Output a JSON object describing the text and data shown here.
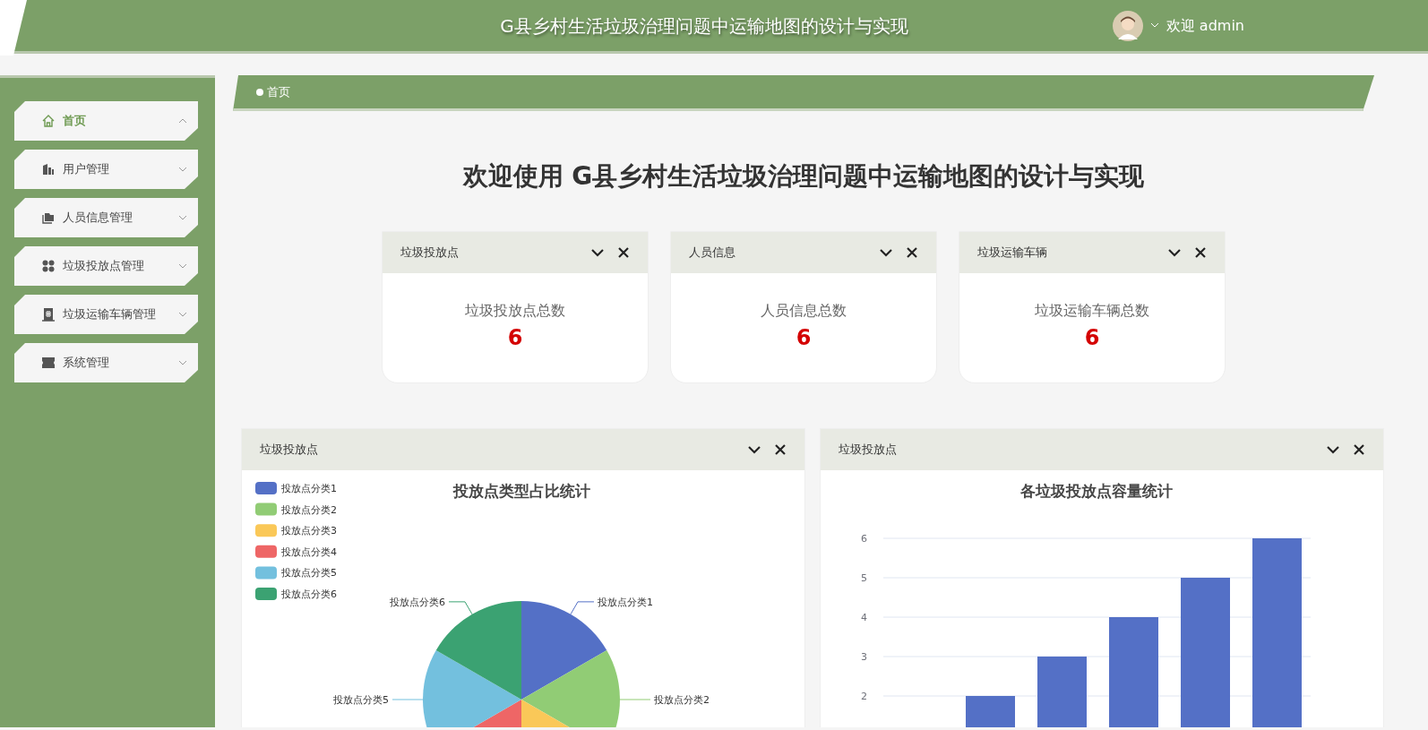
{
  "header": {
    "title": "G县乡村生活垃圾治理问题中运输地图的设计与实现",
    "user_greeting": "欢迎 admin"
  },
  "sidebar": {
    "items": [
      {
        "label": "首页",
        "selected": true,
        "expanded": true
      },
      {
        "label": "用户管理",
        "selected": false,
        "expanded": false
      },
      {
        "label": "人员信息管理",
        "selected": false,
        "expanded": false
      },
      {
        "label": "垃圾投放点管理",
        "selected": false,
        "expanded": false
      },
      {
        "label": "垃圾运输车辆管理",
        "selected": false,
        "expanded": false
      },
      {
        "label": "系统管理",
        "selected": false,
        "expanded": false
      }
    ]
  },
  "breadcrumb": [
    "首页"
  ],
  "welcome_title": "欢迎使用 G县乡村生活垃圾治理问题中运输地图的设计与实现",
  "stat_cards": [
    {
      "title": "垃圾投放点",
      "label": "垃圾投放点总数",
      "value": "6"
    },
    {
      "title": "人员信息",
      "label": "人员信息总数",
      "value": "6"
    },
    {
      "title": "垃圾运输车辆",
      "label": "垃圾运输车辆总数",
      "value": "6"
    }
  ],
  "chart_cards": [
    {
      "title": "垃圾投放点",
      "chart_data": {
        "type": "pie",
        "title": "投放点类型占比统计",
        "categories": [
          "投放点分类1",
          "投放点分类2",
          "投放点分类3",
          "投放点分类4",
          "投放点分类5",
          "投放点分类6"
        ],
        "values": [
          1,
          1,
          1,
          1,
          1,
          1
        ],
        "legend": "top-left"
      }
    },
    {
      "title": "垃圾投放点",
      "chart_data": {
        "type": "bar",
        "title": "各垃圾投放点容量统计",
        "values": [
          null,
          2,
          3,
          4,
          5,
          6
        ],
        "ylim": [
          0,
          6
        ],
        "yticks": [
          2,
          3,
          4,
          5,
          6
        ],
        "grid": true
      }
    }
  ]
}
